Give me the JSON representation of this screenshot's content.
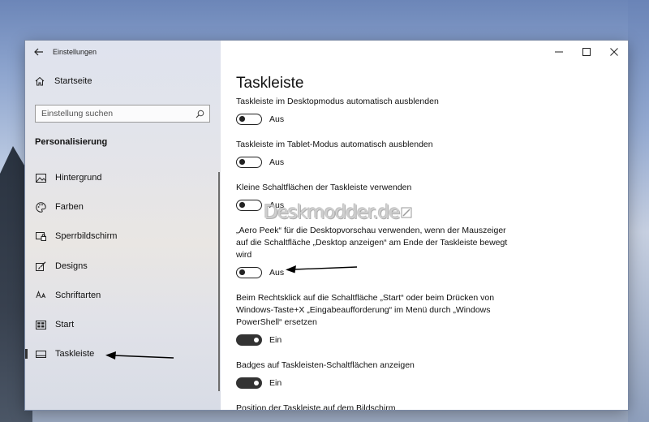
{
  "window": {
    "title": "Einstellungen",
    "controls": [
      "minimize",
      "maximize",
      "close"
    ]
  },
  "sidebar": {
    "home_label": "Startseite",
    "search_placeholder": "Einstellung suchen",
    "section_heading": "Personalisierung",
    "items": [
      {
        "label": "Hintergrund",
        "icon": "picture-icon"
      },
      {
        "label": "Farben",
        "icon": "palette-icon"
      },
      {
        "label": "Sperrbildschirm",
        "icon": "lock-screen-icon"
      },
      {
        "label": "Designs",
        "icon": "brush-icon"
      },
      {
        "label": "Schriftarten",
        "icon": "font-icon"
      },
      {
        "label": "Start",
        "icon": "start-menu-icon"
      },
      {
        "label": "Taskleiste",
        "icon": "taskbar-icon",
        "active": true
      }
    ]
  },
  "content": {
    "title": "Taskleiste",
    "settings": [
      {
        "label": "Taskleiste im Desktopmodus automatisch ausblenden",
        "state": "Aus",
        "on": false
      },
      {
        "label": "Taskleiste im Tablet-Modus automatisch ausblenden",
        "state": "Aus",
        "on": false
      },
      {
        "label": "Kleine Schaltflächen der Taskleiste verwenden",
        "state": "Aus",
        "on": false
      },
      {
        "label": "„Aero Peek“ für die Desktopvorschau verwenden, wenn der Mauszeiger auf die Schaltfläche „Desktop anzeigen“ am Ende der Taskleiste bewegt wird",
        "state": "Aus",
        "on": false
      },
      {
        "label": "Beim Rechtsklick auf die Schaltfläche „Start“ oder beim Drücken von Windows-Taste+X „Eingabeaufforderung“ im Menü durch „Windows PowerShell“ ersetzen",
        "state": "Ein",
        "on": true
      },
      {
        "label": "Badges auf Taskleisten-Schaltflächen anzeigen",
        "state": "Ein",
        "on": true
      },
      {
        "label": "Position der Taskleiste auf dem Bildschirm"
      }
    ]
  },
  "watermark": "Deskmodder.de",
  "colors": {
    "accent": "#333333",
    "annotation_arrow": "#000000"
  }
}
